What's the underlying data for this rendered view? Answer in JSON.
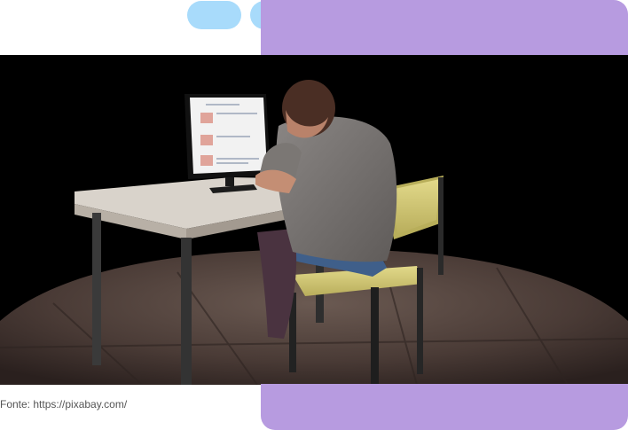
{
  "caption": "Fonte: https://pixabay.com/",
  "colors": {
    "accent_blue": "#a8dbfb",
    "accent_purple": "#b79be0"
  },
  "image": {
    "description_icon": "person-at-computer-illustration"
  }
}
